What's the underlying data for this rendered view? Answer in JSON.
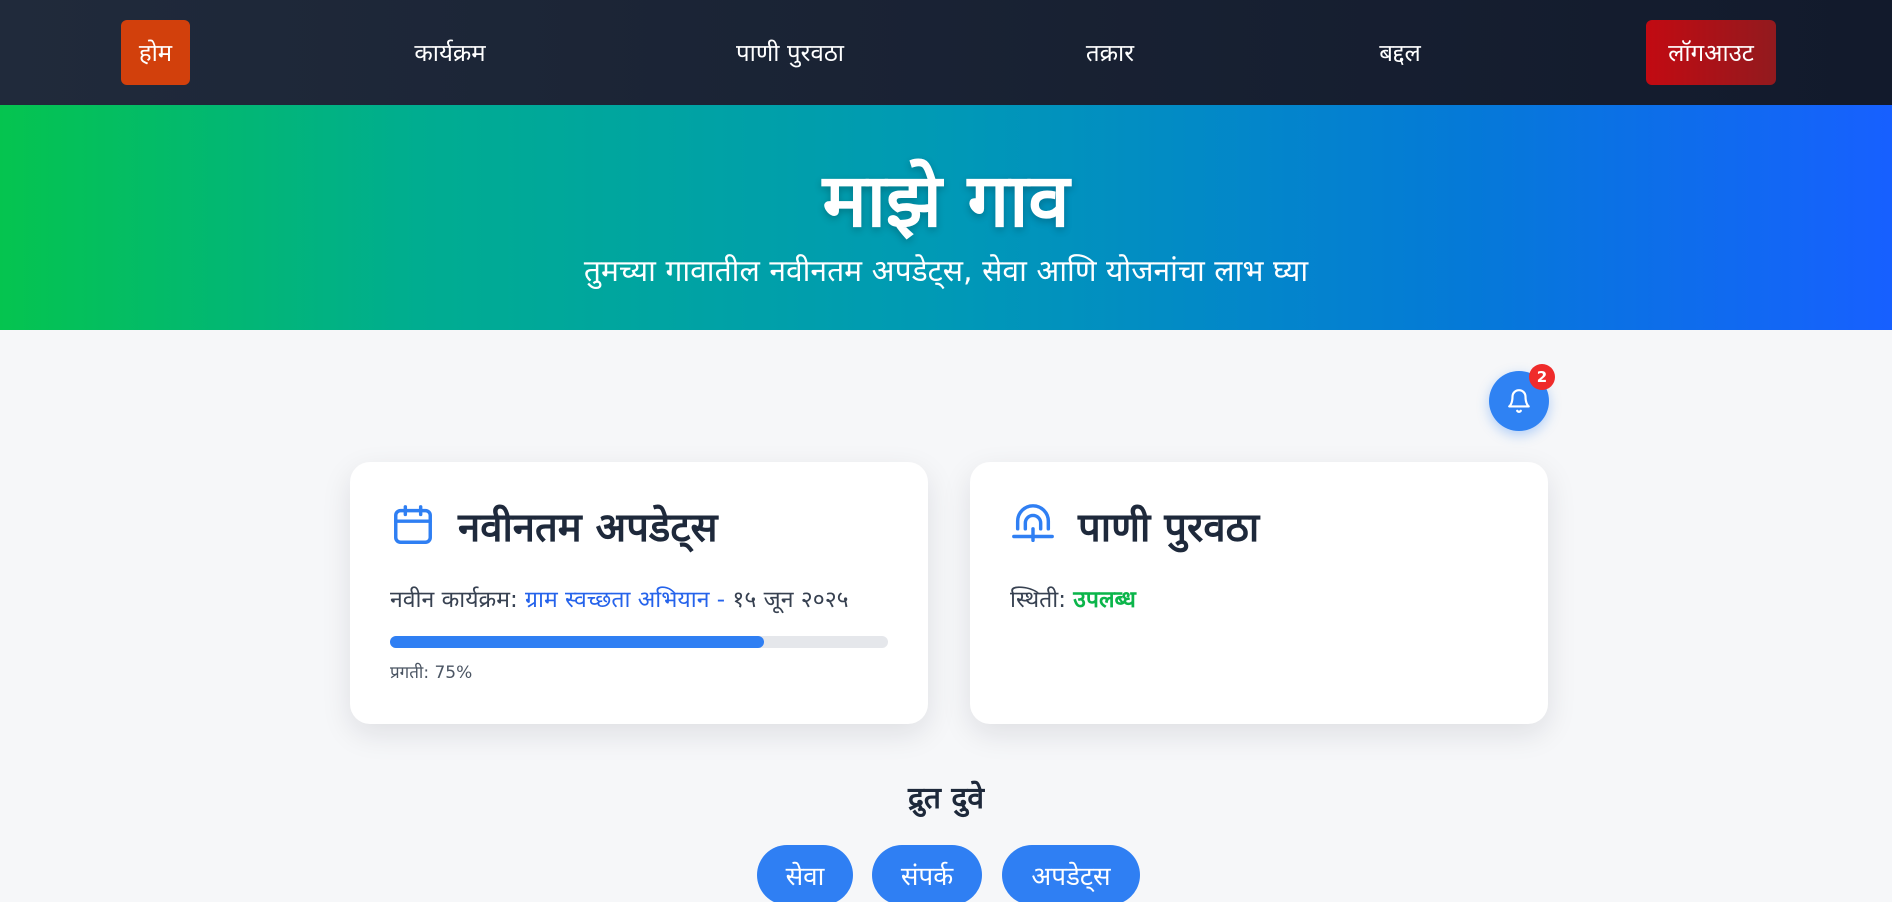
{
  "nav": {
    "home": "होम",
    "programs": "कार्यक्रम",
    "water": "पाणी पुरवठा",
    "complaint": "तक्रार",
    "about": "बद्दल",
    "logout": "लॉगआउट"
  },
  "hero": {
    "title": "माझे गाव",
    "subtitle": "तुमच्या गावातील नवीनतम अपडेट्स, सेवा आणि योजनांचा लाभ घ्या"
  },
  "notifications": {
    "count": "2",
    "icon": "bell-icon"
  },
  "updates_card": {
    "icon": "calendar-icon",
    "title": "नवीनतम अपडेट्स",
    "prefix": "नवीन कार्यक्रम: ",
    "program": "ग्राम स्वच्छता अभियान",
    "separator": " - ",
    "date": "१५ जून २०२५",
    "progress_label": "प्रगती: 75%",
    "progress_value": 0.75
  },
  "water_card": {
    "icon": "water-tap-icon",
    "title": "पाणी पुरवठा",
    "status_prefix": "स्थिती: ",
    "status": "उपलब्ध"
  },
  "quick_links": {
    "title": "द्रुत दुवे",
    "items": [
      "सेवा",
      "संपर्क",
      "अपडेट्स"
    ]
  },
  "colors": {
    "accent": "#2f7ff3",
    "home_button": "#d2400c",
    "logout_button": "#c20a12",
    "status_available": "#0bb54a",
    "badge": "#ef2b2b"
  }
}
